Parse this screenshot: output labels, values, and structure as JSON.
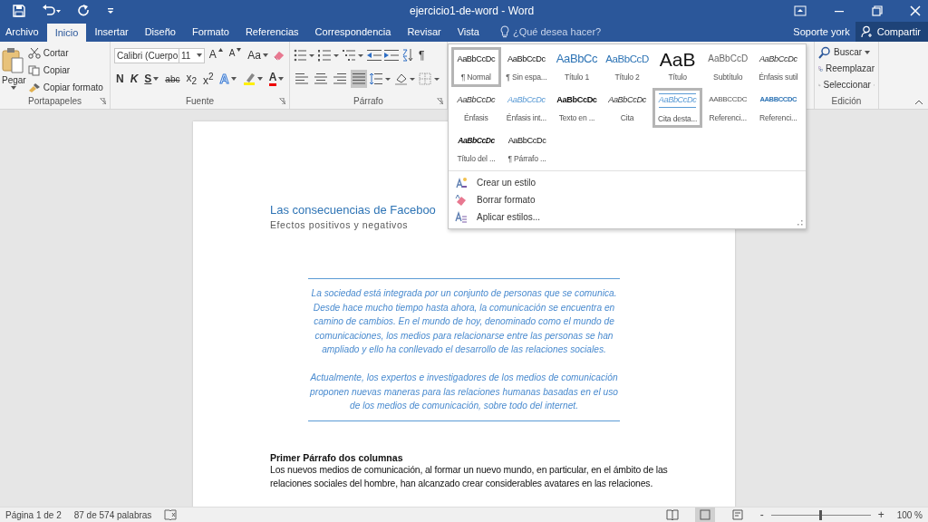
{
  "title_bar": {
    "title": "ejercicio1-de-word - Word"
  },
  "tabs": [
    {
      "label": "Archivo",
      "selected": false
    },
    {
      "label": "Inicio",
      "selected": true
    },
    {
      "label": "Insertar",
      "selected": false
    },
    {
      "label": "Diseño",
      "selected": false
    },
    {
      "label": "Formato",
      "selected": false
    },
    {
      "label": "Referencias",
      "selected": false
    },
    {
      "label": "Correspondencia",
      "selected": false
    },
    {
      "label": "Revisar",
      "selected": false
    },
    {
      "label": "Vista",
      "selected": false
    }
  ],
  "tell_me": {
    "placeholder": "¿Qué desea hacer?"
  },
  "user": "Soporte york",
  "share": "Compartir",
  "ribbon": {
    "clipboard": {
      "label": "Portapapeles",
      "paste": "Pegar",
      "items": [
        {
          "label": "Cortar",
          "kind": "cut"
        },
        {
          "label": "Copiar",
          "kind": "copy"
        },
        {
          "label": "Copiar formato",
          "kind": "brush"
        }
      ]
    },
    "font": {
      "label": "Fuente",
      "font_name": "Calibri (Cuerpo",
      "font_size": "11",
      "row1": [
        {
          "label": "A",
          "kind": "grow"
        },
        {
          "label": "A",
          "kind": "shrink"
        },
        {
          "label": "Aa",
          "kind": "case"
        }
      ],
      "row2": [
        {
          "label": "N",
          "kind": "bold"
        },
        {
          "label": "K",
          "kind": "italic"
        },
        {
          "label": "S",
          "kind": "underline"
        },
        {
          "label": "abc",
          "kind": "strike"
        },
        {
          "label": "x$_{2}$",
          "kind": "sub"
        },
        {
          "label": "x$^{2}$",
          "kind": "sup"
        },
        {
          "label": "A",
          "kind": "effects"
        },
        {
          "kind": "highlight"
        },
        {
          "label": "A",
          "kind": "color"
        }
      ]
    },
    "paragraph": {
      "label": "Párrafo",
      "pilcrow": "¶",
      "align": [
        {
          "kind": "left",
          "selected": false
        },
        {
          "kind": "center",
          "selected": false
        },
        {
          "kind": "right",
          "selected": false
        },
        {
          "kind": "justify",
          "selected": true
        }
      ]
    },
    "editing": {
      "label": "Edición",
      "items": [
        {
          "label": "Buscar",
          "kind": "search"
        },
        {
          "label": "Reemplazar",
          "kind": "replace"
        },
        {
          "label": "Seleccionar",
          "kind": "select"
        }
      ]
    }
  },
  "styles_gallery": {
    "styles": [
      {
        "preview": "AaBbCcDc",
        "label": "¶ Normal",
        "kind": "normal",
        "selected": true
      },
      {
        "preview": "AaBbCcDc",
        "label": "¶ Sin espa...",
        "kind": "normal",
        "selected": false
      },
      {
        "preview": "AaBbCc",
        "label": "Título 1",
        "kind": "h1",
        "selected": false
      },
      {
        "preview": "AaBbCcD",
        "label": "Título 2",
        "kind": "h2",
        "selected": false
      },
      {
        "preview": "AaB",
        "label": "Título",
        "kind": "title",
        "selected": false
      },
      {
        "preview": "AaBbCcD",
        "label": "Subtítulo",
        "kind": "subtitle",
        "selected": false
      },
      {
        "preview": "AaBbCcDc",
        "label": "Énfasis sutil",
        "kind": "emphasis",
        "selected": false
      },
      {
        "preview": "AaBbCcDc",
        "label": "Énfasis",
        "kind": "emphasis",
        "selected": false
      },
      {
        "preview": "AaBbCcDc",
        "label": "Énfasis int...",
        "kind": "intense",
        "selected": false
      },
      {
        "preview": "AaBbCcDc",
        "label": "Texto en ...",
        "kind": "strong",
        "selected": false
      },
      {
        "preview": "AaBbCcDc",
        "label": "Cita",
        "kind": "emphasis",
        "selected": false
      },
      {
        "preview": "AaBbCcDc",
        "label": "Cita desta...",
        "kind": "quote",
        "selected": true
      },
      {
        "preview": "AABBCCDC",
        "label": "Referenci...",
        "kind": "ref",
        "selected": false
      },
      {
        "preview": "AABBCCDC",
        "label": "Referenci...",
        "kind": "intense-ref",
        "selected": false
      },
      {
        "preview": "AaBbCcDc",
        "label": "Título del ...",
        "kind": "book",
        "selected": false
      },
      {
        "preview": "AaBbCcDc",
        "label": "¶ Párrafo ...",
        "kind": "normal",
        "selected": false
      }
    ],
    "commands": [
      {
        "label": "Crear un estilo",
        "kind": "create"
      },
      {
        "label": "Borrar formato",
        "kind": "clear"
      },
      {
        "label": "Aplicar estilos...",
        "kind": "apply"
      }
    ]
  },
  "document": {
    "title": "Las consecuencias de Faceboo",
    "subtitle": "Efectos positivos y negativos",
    "quote": [
      "La sociedad está integrada por un conjunto de personas que se comunica. Desde hace mucho tiempo hasta ahora, la comunicación se encuentra en camino de cambios. En el mundo de hoy, denominado como el mundo de comunicaciones, los medios para relacionarse entre las personas se han ampliado y ello ha conllevado el desarrollo de las relaciones sociales.",
      "Actualmente, los expertos e investigadores de los medios de comunicación proponen nuevas maneras para las relaciones humanas basadas en el uso de los medios de comunicación, sobre todo del internet."
    ],
    "heading": "Primer Párrafo dos columnas",
    "body": "Los nuevos medios de comunicación, al formar un nuevo mundo, en particular, en el ámbito de las relaciones sociales del hombre, han alcanzado crear considerables avatares en las relaciones."
  },
  "status_bar": {
    "page": "Página 1 de 2",
    "words": "87 de 574 palabras",
    "views": [
      {
        "kind": "read",
        "selected": false
      },
      {
        "kind": "print",
        "selected": true
      },
      {
        "kind": "web",
        "selected": false
      }
    ],
    "zoom_out": "-",
    "zoom_in": "+",
    "zoom": {
      "level": 0.5,
      "reading": "100 %"
    }
  }
}
